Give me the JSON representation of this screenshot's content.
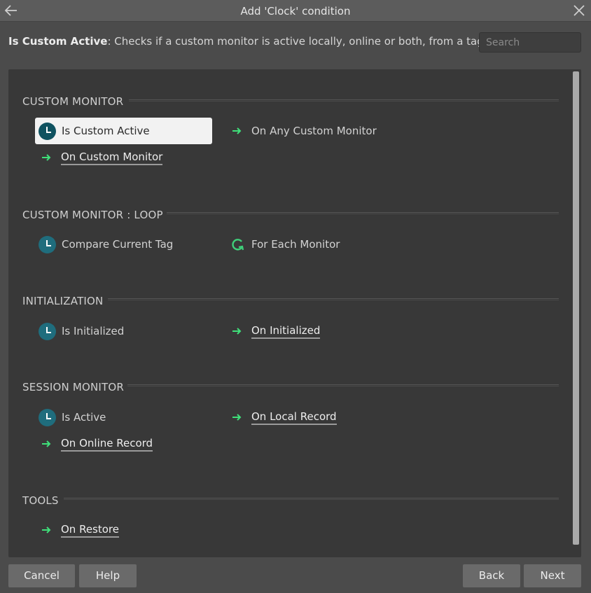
{
  "window": {
    "title": "Add 'Clock' condition"
  },
  "description": {
    "name": "Is Custom Active",
    "text": ": Checks if a custom monitor is active locally, online or both, from a tag."
  },
  "search": {
    "placeholder": "Search",
    "value": ""
  },
  "sections": [
    {
      "header": "CUSTOM MONITOR",
      "items": [
        {
          "label": "Is Custom Active",
          "kind": "condition",
          "icon": "clock-icon",
          "selected": true
        },
        {
          "label": "On Any Custom Monitor",
          "kind": "trigger",
          "icon": "trigger-arrow-icon"
        },
        {
          "label": "On Custom Monitor",
          "kind": "trigger-underlined",
          "icon": "trigger-arrow-icon"
        }
      ]
    },
    {
      "header": "CUSTOM MONITOR : LOOP",
      "items": [
        {
          "label": "Compare Current Tag",
          "kind": "condition",
          "icon": "clock-icon"
        },
        {
          "label": "For Each Monitor",
          "kind": "loop",
          "icon": "loop-icon"
        }
      ]
    },
    {
      "header": "INITIALIZATION",
      "items": [
        {
          "label": "Is Initialized",
          "kind": "condition",
          "icon": "clock-icon"
        },
        {
          "label": "On Initialized",
          "kind": "trigger-underlined",
          "icon": "trigger-arrow-icon"
        }
      ]
    },
    {
      "header": "SESSION MONITOR",
      "items": [
        {
          "label": "Is Active",
          "kind": "condition",
          "icon": "clock-icon"
        },
        {
          "label": "On Local Record",
          "kind": "trigger-underlined",
          "icon": "trigger-arrow-icon"
        },
        {
          "label": "On Online Record",
          "kind": "trigger-underlined",
          "icon": "trigger-arrow-icon"
        }
      ]
    },
    {
      "header": "TOOLS",
      "items": [
        {
          "label": "On Restore",
          "kind": "trigger-underlined",
          "icon": "trigger-arrow-icon"
        }
      ]
    }
  ],
  "buttons": {
    "cancel": "Cancel",
    "help": "Help",
    "back": "Back",
    "next": "Next"
  },
  "colors": {
    "clock_icon": "#1f6d7d",
    "trigger_arrow": "#3fe07a",
    "loop_icon": "#3fd07a",
    "selected_bg": "#f2f2f2"
  }
}
